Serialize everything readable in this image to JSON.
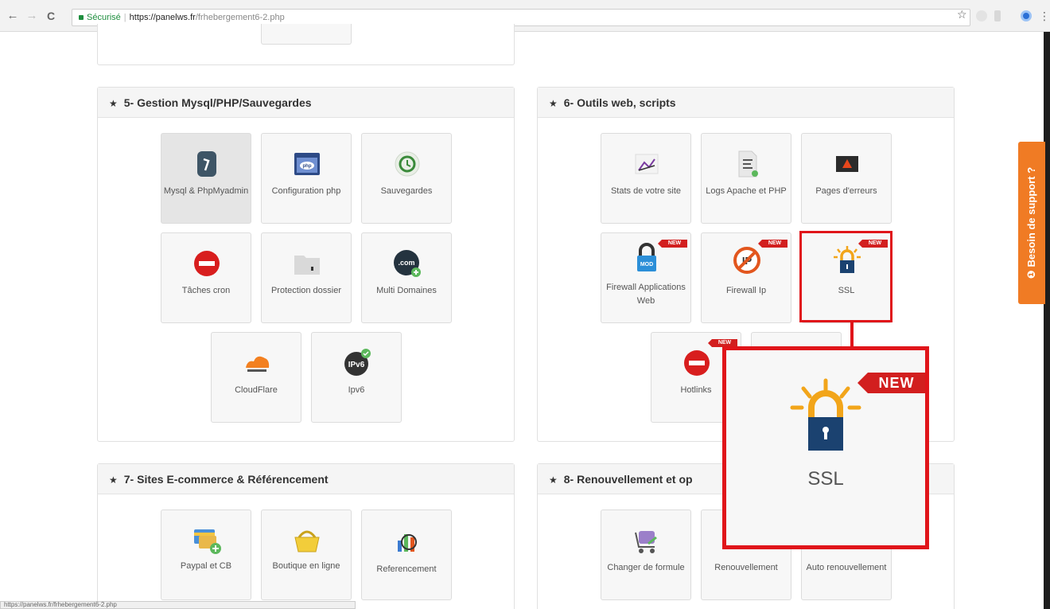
{
  "browser": {
    "security_label": "Sécurisé",
    "url_host": "https://panelws.fr",
    "url_path": "/frhebergement6-2.php",
    "status_url": "https://panelws.fr/frhebergement6-2.php"
  },
  "sections": {
    "mysql": {
      "title": "5- Gestion Mysql/PHP/Sauvegardes",
      "tiles": [
        {
          "label": "Mysql & PhpMyadmin",
          "icon": "database-icon"
        },
        {
          "label": "Configuration php",
          "icon": "php-window-icon"
        },
        {
          "label": "Sauvegardes",
          "icon": "backup-icon"
        },
        {
          "label": "Tâches cron",
          "icon": "no-entry-icon"
        },
        {
          "label": "Protection dossier",
          "icon": "folder-lock-icon"
        },
        {
          "label": "Multi Domaines",
          "icon": "dotcom-icon"
        },
        {
          "label": "CloudFlare",
          "icon": "cloudflare-icon"
        },
        {
          "label": "Ipv6",
          "icon": "ipv6-icon"
        }
      ]
    },
    "tools": {
      "title": "6- Outils web, scripts",
      "tiles": [
        {
          "label": "Stats de votre site",
          "icon": "stats-icon"
        },
        {
          "label": "Logs Apache et PHP",
          "icon": "log-file-icon"
        },
        {
          "label": "Pages d'erreurs",
          "icon": "warning-icon"
        },
        {
          "label": "Firewall Applications Web",
          "icon": "firewall-lock-icon",
          "badge": "NEW"
        },
        {
          "label": "Firewall Ip",
          "icon": "ip-blocked-icon",
          "badge": "NEW"
        },
        {
          "label": "SSL",
          "icon": "ssl-lock-icon",
          "badge": "NEW"
        },
        {
          "label": "Hotlinks",
          "icon": "no-entry-icon",
          "badge": "NEW"
        }
      ]
    },
    "ecommerce": {
      "title": "7- Sites E-commerce & Référencement",
      "tiles": [
        {
          "label": "Paypal et CB",
          "icon": "payment-icon"
        },
        {
          "label": "Boutique en ligne",
          "icon": "shopping-basket-icon"
        },
        {
          "label": "Referencement",
          "icon": "seo-chart-icon"
        }
      ]
    },
    "renewal": {
      "title": "8- Renouvellement et op",
      "tiles": [
        {
          "label": "Changer de formule",
          "icon": "cart-icon"
        },
        {
          "label": "Renouvellement",
          "icon": "renew-icon"
        },
        {
          "label": "Auto renouvellement",
          "icon": "auto-renew-icon"
        }
      ]
    }
  },
  "zoom": {
    "badge": "NEW",
    "label": "SSL"
  },
  "support": {
    "label": "Besoin de support ?"
  },
  "colors": {
    "accent_red": "#e0151a",
    "support_orange": "#f07b24",
    "new_badge": "#d21f1f"
  }
}
